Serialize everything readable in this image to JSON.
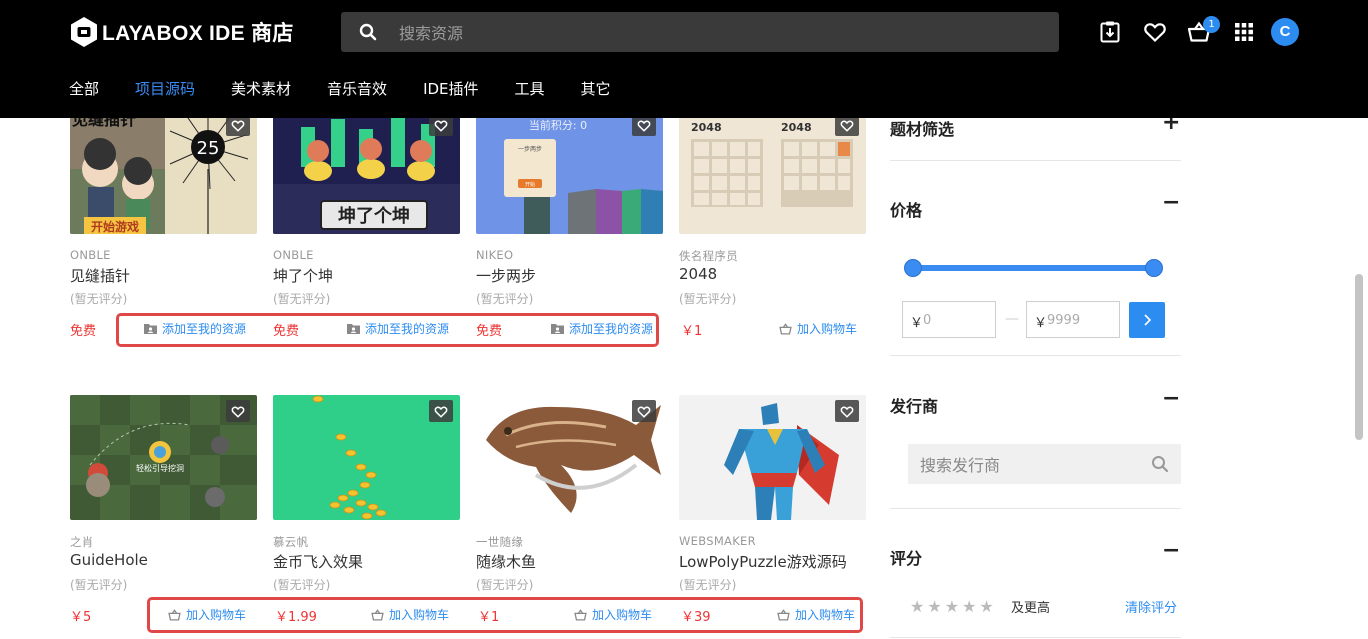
{
  "header": {
    "logo_text": "LAYABOX IDE 商店",
    "search_placeholder": "搜索资源",
    "cart_count": "1",
    "avatar_letter": "C"
  },
  "nav": [
    "全部",
    "项目源码",
    "美术素材",
    "音乐音效",
    "IDE插件",
    "工具",
    "其它"
  ],
  "nav_active": "项目源码",
  "products": [
    {
      "publisher": "ONBLE",
      "title": "见缝插针",
      "rating": "(暂无评分)",
      "price": "免费",
      "action": "添加至我的资源",
      "thumb_text_top": "见缝插针",
      "thumb_number": "25",
      "thumb_banner": "开始游戏"
    },
    {
      "publisher": "ONBLE",
      "title": "坤了个坤",
      "rating": "(暂无评分)",
      "price": "免费",
      "action": "添加至我的资源",
      "thumb_banner": "坤了个坤"
    },
    {
      "publisher": "NIKEO",
      "title": "一步两步",
      "rating": "(暂无评分)",
      "price": "免费",
      "action": "添加至我的资源",
      "thumb_score": "当前积分: 0",
      "thumb_card_title": "一步两步",
      "thumb_card_btn": "开始"
    },
    {
      "publisher": "佚名程序员",
      "title": "2048",
      "rating": "(暂无评分)",
      "price": "￥1",
      "action": "加入购物车",
      "thumb_label_a": "2048",
      "thumb_label_b": "2048"
    },
    {
      "publisher": "之肖",
      "title": "GuideHole",
      "rating": "(暂无评分)",
      "price": "￥5",
      "action": "加入购物车",
      "thumb_caption": "轻松引导挖洞"
    },
    {
      "publisher": "慕云帆",
      "title": "金币飞入效果",
      "rating": "(暂无评分)",
      "price": "￥1.99",
      "action": "加入购物车"
    },
    {
      "publisher": "一世随缘",
      "title": "随缘木鱼",
      "rating": "(暂无评分)",
      "price": "￥1",
      "action": "加入购物车"
    },
    {
      "publisher": "WEBSMAKER",
      "title": "LowPolyPuzzle游戏源码",
      "rating": "(暂无评分)",
      "price": "￥39",
      "action": "加入购物车"
    }
  ],
  "sidebar": {
    "theme_filter": "题材筛选",
    "price_title": "价格",
    "price_currency": "￥",
    "price_min_placeholder": "0",
    "price_max_placeholder": "9999",
    "publisher_title": "发行商",
    "publisher_placeholder": "搜索发行商",
    "rating_title": "评分",
    "rating_and_up": "及更高",
    "rating_clear": "清除评分"
  },
  "colors": {
    "accent": "#2d8cf0",
    "price": "#e33333",
    "highlight": "#e04848",
    "header": "#000000"
  }
}
